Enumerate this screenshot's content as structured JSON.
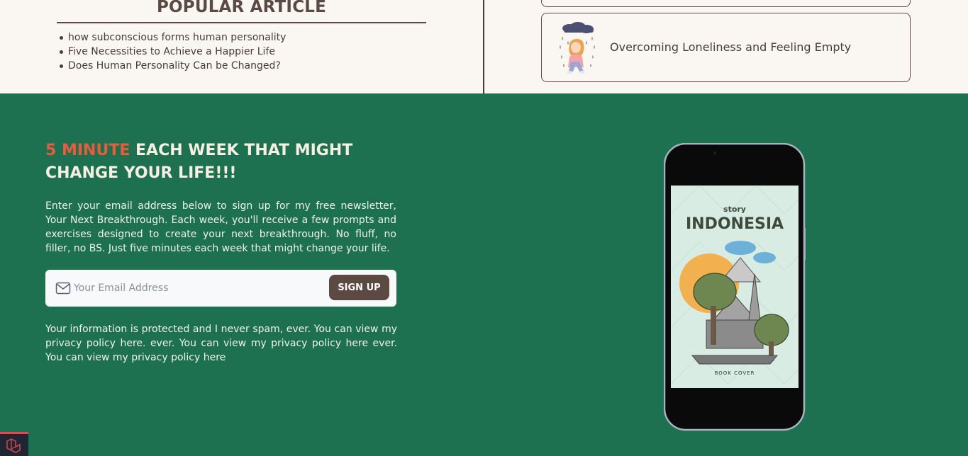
{
  "popular": {
    "title": "POPULAR ARTICLE",
    "items": [
      "how subconscious forms human personality",
      "Five Necessities to Achieve a Happier Life",
      "Does Human Personality Can be Changed?"
    ]
  },
  "featured_card": {
    "title": "Overcoming Loneliness and Feeling Empty",
    "thumbnail_icon": "sad-girl-rain-cloud-illustration"
  },
  "newsletter": {
    "headline_accent": "5 MINUTE",
    "headline_rest": " EACH WEEK THAT MIGHT CHANGE YOUR LIFE!!!",
    "description": "Enter your email address below to sign up for my free newsletter, Your Next Breakthrough. Each week, you'll receive a few prompts and exercises designed to create your next breakthrough. No fluff, no filler, no BS. Just five minutes each week that might change your life.",
    "email_placeholder": "Your Email Address",
    "email_value": "",
    "signup_label": "SIGN UP",
    "notice": "Your information is protected and I never spam, ever. You can view my privacy policy here. ever. You can view my privacy policy here ever. You can view my privacy policy here"
  },
  "phone_cover": {
    "small_title": "story",
    "big_title": "INDONESIA",
    "footer": "BOOK COVER"
  },
  "colors": {
    "page_green": "#1e7150",
    "cream": "#faf7f3",
    "brown": "#5a4a43",
    "accent_orange": "#e85c3b",
    "button_brown": "#5c4a42"
  }
}
